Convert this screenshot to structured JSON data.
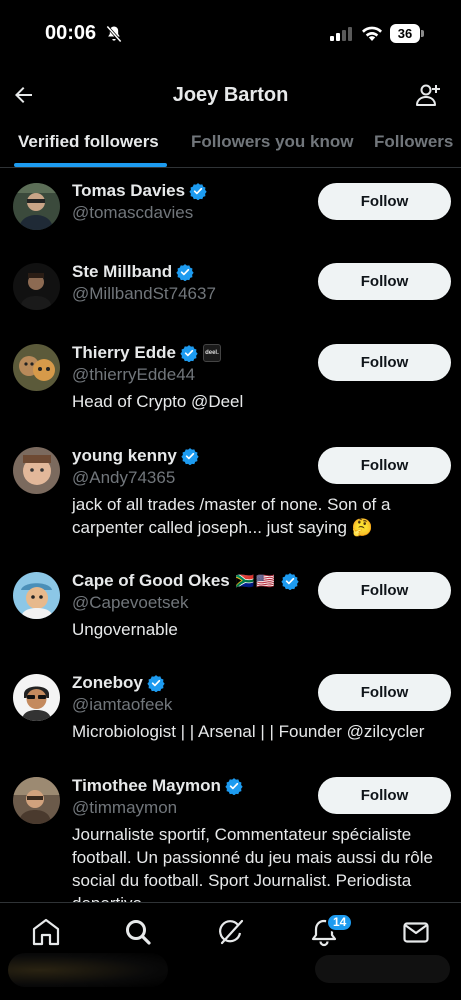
{
  "status_bar": {
    "time": "00:06",
    "battery": "36",
    "bell_icon": "bell-muted-icon",
    "signal_icon": "cellular-signal-icon",
    "wifi_icon": "wifi-icon"
  },
  "header": {
    "title": "Joey Barton",
    "back_icon": "arrow-left-icon",
    "add_icon": "add-person-icon"
  },
  "tabs": [
    {
      "label": "Verified followers",
      "active": true
    },
    {
      "label": "Followers you know",
      "active": false
    },
    {
      "label": "Followers",
      "active": false
    }
  ],
  "users": [
    {
      "name": "Tomas Davies",
      "handle": "@tomascdavies",
      "bio": "",
      "follow": "Follow"
    },
    {
      "name": "Ste Millband",
      "handle": "@MillbandSt74637",
      "bio": "",
      "follow": "Follow"
    },
    {
      "name": "Thierry Edde",
      "badge": "deel.",
      "handle": "@thierryEdde44",
      "bio": "Head of Crypto @Deel",
      "follow": "Follow"
    },
    {
      "name": "young kenny",
      "handle": "@Andy74365",
      "bio": "jack of all trades /master of none. Son of a carpenter called joseph... just saying 🤔",
      "follow": "Follow"
    },
    {
      "name": "Cape of Good Okes",
      "flags": "🇿🇦🇺🇸",
      "handle": "@Capevoetsek",
      "bio": "Ungovernable",
      "follow": "Follow"
    },
    {
      "name": "Zoneboy",
      "handle": "@iamtaofeek",
      "bio": "Microbiologist | | Arsenal | | Founder @zilcycler",
      "follow": "Follow"
    },
    {
      "name": "Timothee Maymon",
      "handle": "@timmaymon",
      "bio": "Journaliste sportif, Commentateur spécialiste football. Un passionné du jeu mais aussi du rôle social du football. Sport Journalist. Periodista deportivo",
      "follow": "Follow"
    }
  ],
  "bottom_nav": {
    "items": [
      "home-icon",
      "search-icon",
      "grok-icon",
      "notifications-icon",
      "messages-icon"
    ],
    "notification_count": "14"
  },
  "colors": {
    "accent": "#1d9bf0",
    "background": "#000000",
    "secondary_text": "#71767b",
    "button_bg": "#eff3f4"
  }
}
